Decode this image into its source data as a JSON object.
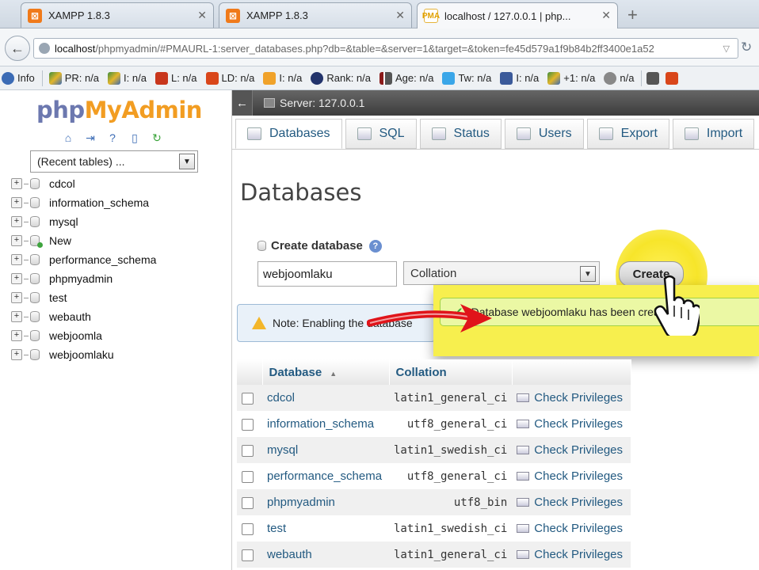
{
  "browser": {
    "tabs": [
      {
        "icon": "xampp-icon",
        "label": "XAMPP 1.8.3"
      },
      {
        "icon": "xampp-icon",
        "label": "XAMPP 1.8.3"
      },
      {
        "icon": "phpmyadmin-icon",
        "label": "localhost / 127.0.0.1 | php..."
      }
    ],
    "url_host": "localhost",
    "url_rest": "/phpmyadmin/#PMAURL-1:server_databases.php?db=&table=&server=1&target=&token=fe45d579a1f9b84b2ff3400e1a52",
    "seo_items": [
      "Info",
      "PR: n/a",
      "I: n/a",
      "L: n/a",
      "LD: n/a",
      "I: n/a",
      "Rank: n/a",
      "Age: n/a",
      "Tw: n/a",
      "I: n/a",
      "+1: n/a",
      "n/a"
    ]
  },
  "nav": {
    "logo_php": "php",
    "logo_myadmin": "MyAdmin",
    "recent_tables": "(Recent tables) ...",
    "databases": [
      "cdcol",
      "information_schema",
      "mysql",
      "New",
      "performance_schema",
      "phpmyadmin",
      "test",
      "webauth",
      "webjoomla",
      "webjoomlaku"
    ]
  },
  "server_bar": {
    "label": "Server: 127.0.0.1"
  },
  "tabs": [
    "Databases",
    "SQL",
    "Status",
    "Users",
    "Export",
    "Import"
  ],
  "page": {
    "title": "Databases",
    "create_label": "Create database",
    "db_name_value": "webjoomlaku",
    "collation": "Collation",
    "create_button": "Create",
    "note": "Note: Enabling the database",
    "success": "Database webjoomlaku has been created."
  },
  "table": {
    "headers": {
      "database": "Database",
      "collation": "Collation"
    },
    "rows": [
      {
        "name": "cdcol",
        "collation": "latin1_general_ci",
        "action": "Check Privileges"
      },
      {
        "name": "information_schema",
        "collation": "utf8_general_ci",
        "action": "Check Privileges"
      },
      {
        "name": "mysql",
        "collation": "latin1_swedish_ci",
        "action": "Check Privileges"
      },
      {
        "name": "performance_schema",
        "collation": "utf8_general_ci",
        "action": "Check Privileges"
      },
      {
        "name": "phpmyadmin",
        "collation": "utf8_bin",
        "action": "Check Privileges"
      },
      {
        "name": "test",
        "collation": "latin1_swedish_ci",
        "action": "Check Privileges"
      },
      {
        "name": "webauth",
        "collation": "latin1_general_ci",
        "action": "Check Privileges"
      }
    ]
  },
  "colors": {
    "link": "#235a81",
    "highlight": "#f7ef4e",
    "success_bg": "#ebf8a4",
    "xampp_orange": "#f07a1a"
  }
}
